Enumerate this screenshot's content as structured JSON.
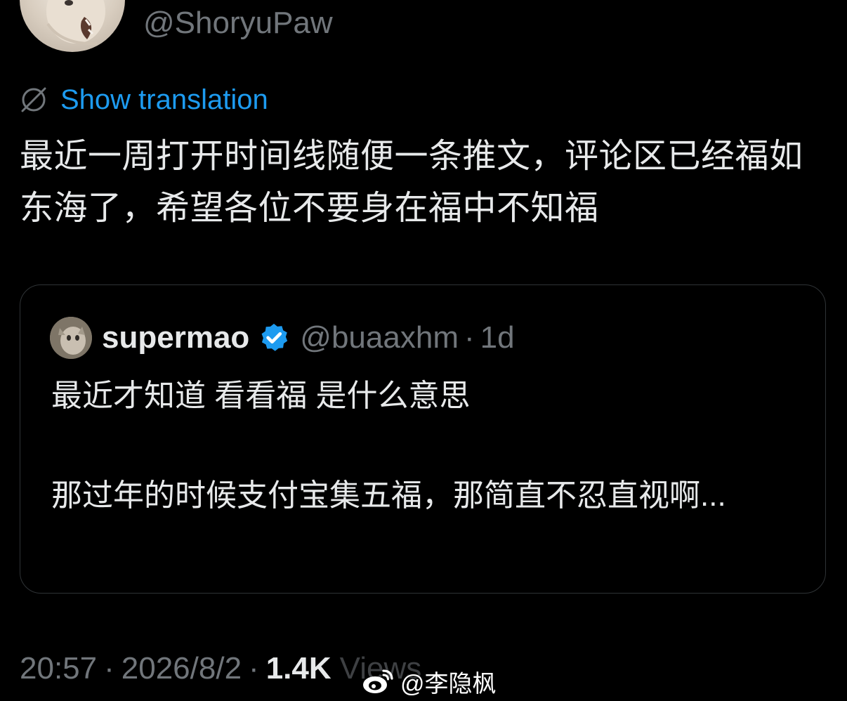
{
  "author": {
    "handle": "@ShoryuPaw"
  },
  "translate": {
    "label": "Show translation",
    "icon": "globe-icon"
  },
  "tweet": {
    "text": "最近一周打开时间线随便一条推文，评论区已经福如东海了，希望各位不要身在福中不知福"
  },
  "quote": {
    "name": "supermao",
    "verified_icon": "verified-badge-icon",
    "handle": "@buaaxhm",
    "separator": "·",
    "time": "1d",
    "text_line_1": "最近才知道 看看福 是什么意思",
    "text_paragraph_2": "那过年的时候支付宝集五福，那简直不忍直视啊..."
  },
  "meta": {
    "time": "20:57",
    "separator": "·",
    "date": "2026/8/2",
    "views_count": "1.4K",
    "views_label": "Views"
  },
  "watermark": {
    "icon": "weibo-icon",
    "text": "@李隐枫"
  },
  "colors": {
    "background": "#000000",
    "text": "#e7e9ea",
    "secondary": "#71767b",
    "link": "#1d9bf0",
    "border": "#2f3336",
    "verified": "#1d9bf0"
  }
}
